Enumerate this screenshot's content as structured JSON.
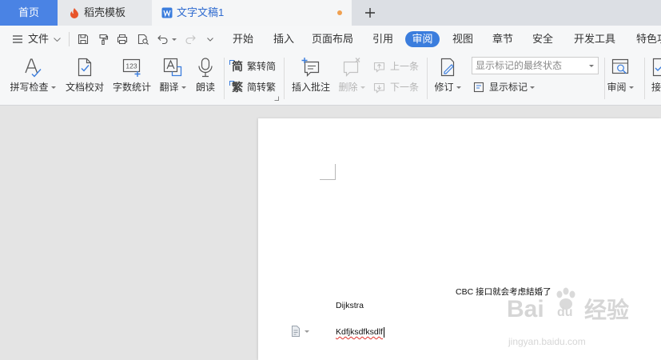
{
  "tabs": {
    "home": "首页",
    "templates": "稻壳模板",
    "document": "文字文稿1"
  },
  "menubar": {
    "file": "文件",
    "items": [
      "开始",
      "插入",
      "页面布局",
      "引用",
      "审阅",
      "视图",
      "章节",
      "安全",
      "开发工具",
      "特色功"
    ],
    "active_index": 4
  },
  "ribbon": {
    "spell_check": {
      "label": "拼写检查",
      "dropdown": true
    },
    "doc_proofread": {
      "label": "文档校对"
    },
    "word_count": {
      "label": "字数统计",
      "icon_text": "123"
    },
    "translate": {
      "label": "翻译",
      "dropdown": true
    },
    "read_aloud": {
      "label": "朗读"
    },
    "trad_to_simp": {
      "label": "繁转简",
      "icon_glyph": "简"
    },
    "simp_to_trad": {
      "label": "简转繁",
      "icon_glyph": "繁"
    },
    "insert_comment": {
      "label": "插入批注"
    },
    "delete": {
      "label": "删除",
      "dropdown": true,
      "enabled": false
    },
    "previous": {
      "label": "上一条",
      "enabled": false
    },
    "next": {
      "label": "下一条",
      "enabled": false
    },
    "track_changes": {
      "label": "修订",
      "dropdown": true
    },
    "markup_mode": {
      "selected": "显示标记的最终状态"
    },
    "show_markup": {
      "label": "显示标记",
      "dropdown": true
    },
    "review_pane": {
      "label": "审阅",
      "dropdown": true
    },
    "accept": {
      "label": "接"
    }
  },
  "document": {
    "paragraphs": [
      {
        "text": "CBC 接口就会考虑結婚了",
        "spelling_error": false
      },
      {
        "text": "Dijkstra",
        "spelling_error": false
      },
      {
        "text": "Kdfjksdfksdlf",
        "spelling_error": true
      }
    ]
  },
  "watermark": {
    "brand_a": "Bai",
    "brand_b": "du",
    "product": "经验",
    "site": "jingyan.baidu.com"
  },
  "colors": {
    "home_tab": "#4a83e4",
    "accent": "#3b7ddd",
    "unsaved_dot": "#f0a050",
    "spelling_underline": "#e0312b",
    "disabled": "#b5b5b5",
    "document_background": "#e4e4e4",
    "page": "#ffffff"
  },
  "icons": {
    "templates_tab": "docer-logo-icon",
    "document_tab": "writer-doc-icon",
    "new_tab": "plus-icon",
    "menu": "hamburger-icon",
    "save": "save-icon",
    "format_painter": "format-painter-icon",
    "print": "print-icon",
    "print_preview": "print-preview-icon",
    "undo": "undo-icon",
    "redo": "redo-icon",
    "spell_check": "spell-check-icon",
    "doc_proofread": "document-check-icon",
    "word_count": "word-count-icon",
    "translate": "translate-icon",
    "read_aloud": "microphone-icon",
    "insert_comment": "insert-comment-icon",
    "delete": "delete-comment-icon",
    "previous": "previous-comment-icon",
    "next": "next-comment-icon",
    "track_changes": "track-changes-icon",
    "show_markup": "show-markup-icon",
    "review_pane": "review-pane-icon",
    "accept": "accept-change-icon"
  }
}
